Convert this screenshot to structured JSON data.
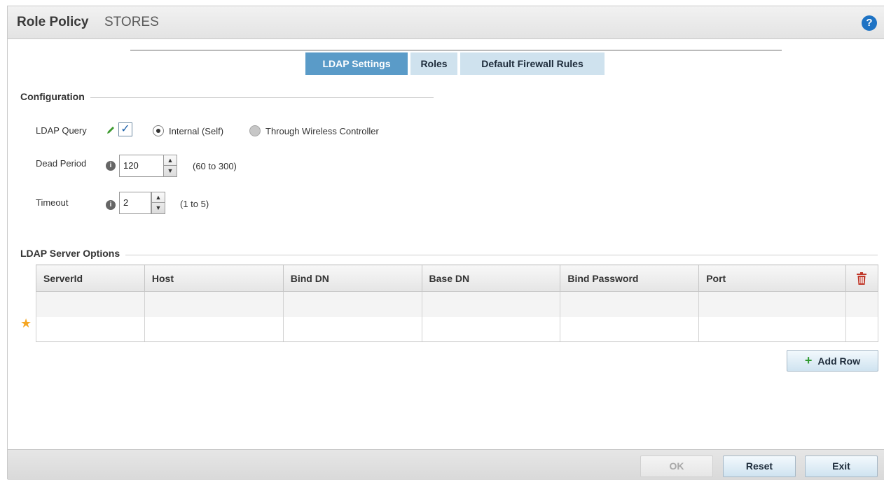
{
  "header": {
    "title": "Role Policy",
    "subtitle": "STORES"
  },
  "tabs": [
    {
      "label": "LDAP Settings",
      "active": true
    },
    {
      "label": "Roles",
      "active": false
    },
    {
      "label": "Default Firewall Rules",
      "active": false
    }
  ],
  "configuration": {
    "section_title": "Configuration",
    "ldap_query": {
      "label": "LDAP Query",
      "checked": true,
      "options": [
        {
          "label": "Internal (Self)",
          "selected": true
        },
        {
          "label": "Through Wireless Controller",
          "selected": false
        }
      ]
    },
    "dead_period": {
      "label": "Dead Period",
      "value": "120",
      "range": "(60 to 300)"
    },
    "timeout": {
      "label": "Timeout",
      "value": "2",
      "range": "(1 to 5)"
    }
  },
  "server_options": {
    "section_title": "LDAP Server Options",
    "columns": [
      "ServerId",
      "Host",
      "Bind DN",
      "Base DN",
      "Bind Password",
      "Port"
    ],
    "add_row_label": "Add Row"
  },
  "footer": {
    "ok_label": "OK",
    "reset_label": "Reset",
    "exit_label": "Exit"
  },
  "colors": {
    "active_tab": "#5a9bc8",
    "help": "#1e73c4",
    "trash": "#c0392b",
    "star": "#f5a623"
  }
}
